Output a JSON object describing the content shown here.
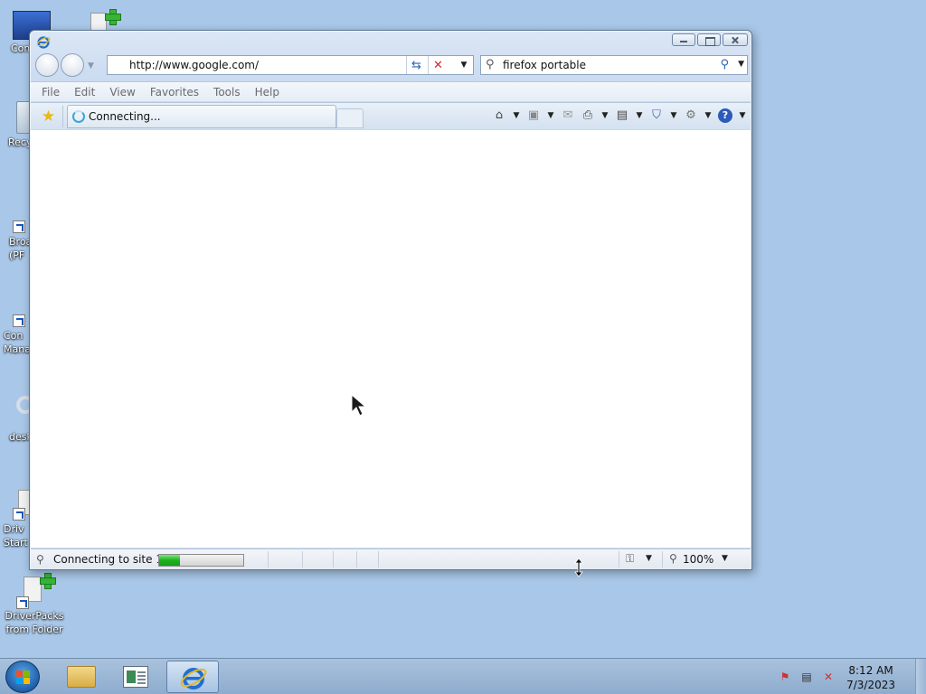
{
  "window": {
    "title": "",
    "address": "http://www.google.com/",
    "search_query": "firefox portable",
    "menu": [
      "File",
      "Edit",
      "View",
      "Favorites",
      "Tools",
      "Help"
    ],
    "tab_label": "Connecting...",
    "status_text": "Connecting to site 14",
    "progress_fraction": 0.25,
    "zoom": "100%",
    "content": ""
  },
  "desktop_icons": [
    {
      "label": "Com",
      "name": "desktop-icon-computer"
    },
    {
      "label": "Recy",
      "name": "desktop-icon-recycle-bin"
    },
    {
      "label": "Broa (PF",
      "name": "desktop-icon-broadcom"
    },
    {
      "label": "Con Mana",
      "name": "desktop-icon-connection-manager"
    },
    {
      "label": "desk",
      "name": "desktop-icon-desktop"
    },
    {
      "label": "Driv Start",
      "name": "desktop-icon-driver-start"
    },
    {
      "label": "DriverPacks from Folder",
      "name": "desktop-icon-driverpacks"
    }
  ],
  "taskbar": {
    "time": "8:12 AM",
    "date": "7/3/2023",
    "buttons": [
      "explorer",
      "app",
      "internet-explorer"
    ]
  },
  "colors": {
    "desktop": "#a9c7e8",
    "accent": "#2c5bb8",
    "progress": "#1fb11f",
    "stop": "#d02a2a"
  }
}
